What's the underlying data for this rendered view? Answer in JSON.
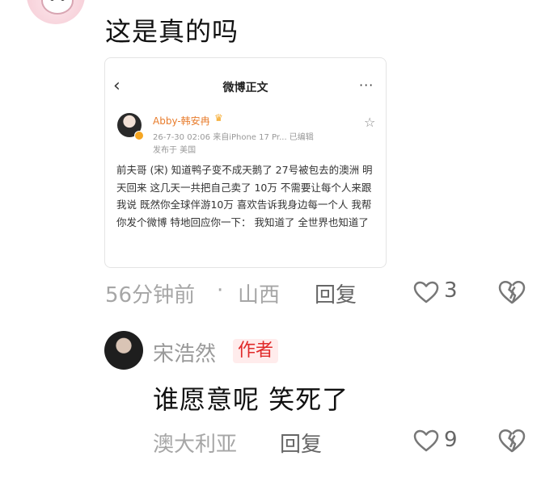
{
  "comment": {
    "text": "这是真的吗",
    "time": "56分钟前",
    "separator": "·",
    "location": "山西",
    "reply_label": "回复",
    "likes": "3"
  },
  "embedded_screenshot": {
    "back_glyph": "‹",
    "title": "微博正文",
    "more_glyph": "···",
    "poster_name": "Abby-韩安冉",
    "poster_meta": "26-7-30 02:06  来自iPhone 17 Pr...  已编辑",
    "poster_location": "发布于 美国",
    "body": "前夫哥 (宋) 知道鸭子变不成天鹅了 27号被包去的澳洲 明天回来 这几天一共把自己卖了 10万 不需要让每个人来跟我说 既然你全球伴游10万 喜欢告诉我身边每一个人 我帮你发个微博 特地回应你一下： 我知道了 全世界也知道了"
  },
  "author_reply": {
    "name": "宋浩然",
    "badge": "作者",
    "text": "谁愿意呢 笑死了",
    "location": "澳大利亚",
    "reply_label": "回复",
    "likes": "9"
  },
  "colors": {
    "badge_bg": "#ffecec",
    "badge_text": "#e02a2a",
    "poster_name": "#e87c2c",
    "meta_gray": "#a6a6a6"
  }
}
